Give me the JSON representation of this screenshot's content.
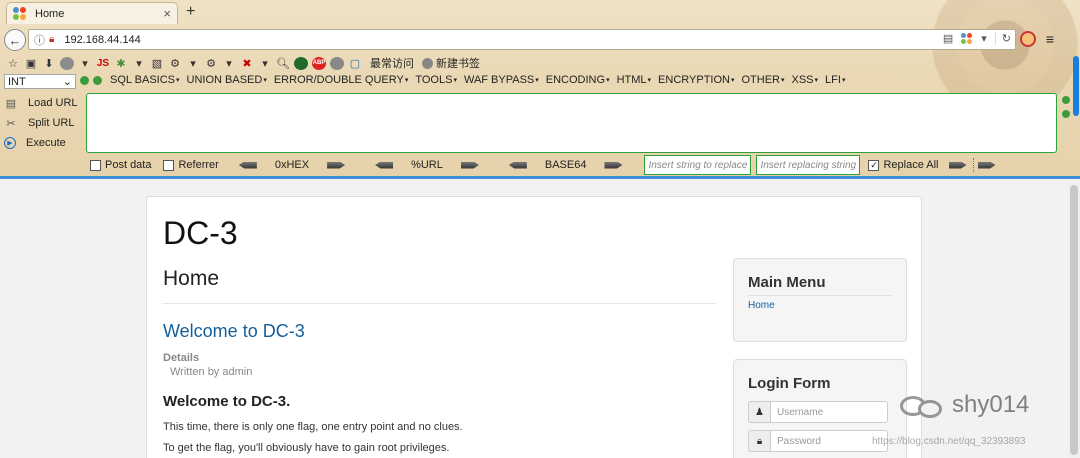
{
  "browser": {
    "tab_title": "Home",
    "new_tab": "+",
    "tab_close": "×",
    "url": "192.168.44.144",
    "bookmarks": [
      "最常访问",
      "新建书签"
    ],
    "bookmark_js": "JS",
    "bookmark_abp": "ABP"
  },
  "hackbar": {
    "select_value": "INT",
    "menus": [
      "SQL BASICS",
      "UNION BASED",
      "ERROR/DOUBLE QUERY",
      "TOOLS",
      "WAF BYPASS",
      "ENCODING",
      "HTML",
      "ENCRYPTION",
      "OTHER",
      "XSS",
      "LFI"
    ],
    "load_url": "Load URL",
    "split_url": "Split URL",
    "execute": "Execute",
    "post_data": "Post data",
    "referrer": "Referrer",
    "hex": "0xHEX",
    "url_enc": "%URL",
    "base64": "BASE64",
    "insert_placeholder": "Insert string to replace",
    "replacing_placeholder": "Insert replacing string",
    "replace_all": "Replace All"
  },
  "page": {
    "site_title": "DC-3",
    "page_heading": "Home",
    "article_title": "Welcome to DC-3",
    "details_label": "Details",
    "author": "Written by admin",
    "article_heading": "Welcome to DC-3.",
    "paragraph1": "This time, there is only one flag, one entry point and no clues.",
    "paragraph2": "To get the flag, you'll obviously have to gain root privileges."
  },
  "sidebar": {
    "main_menu_title": "Main Menu",
    "main_menu_link": "Home",
    "login_title": "Login Form",
    "username_placeholder": "Username",
    "password_placeholder": "Password"
  },
  "watermark": {
    "name": "shy014",
    "source": "https://blog.csdn.net/qq_32393893"
  },
  "colors": {
    "link": "#145e9a",
    "hackbar_border": "#2ea23a",
    "accent_bar": "#3e8ed6"
  }
}
